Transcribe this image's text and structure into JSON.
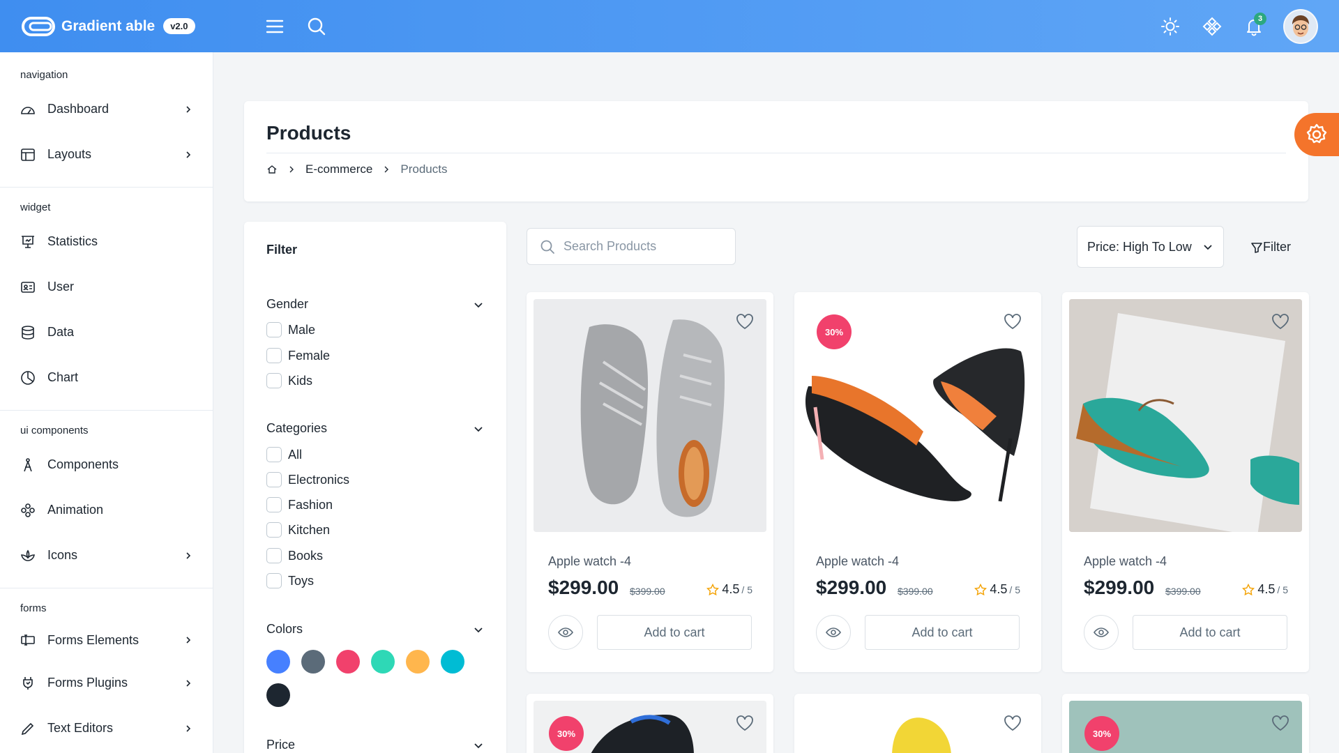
{
  "header": {
    "brand_name": "Gradient able",
    "version": "v2.0",
    "notification_count": "3",
    "icons": [
      "menu-icon",
      "search-icon",
      "sun-icon",
      "diamond-icon",
      "bell-icon"
    ]
  },
  "sidebar": {
    "sections": [
      {
        "caption": "navigation",
        "items": [
          {
            "label": "Dashboard",
            "icon": "dashboard-icon",
            "has_chevron": true
          },
          {
            "label": "Layouts",
            "icon": "layout-icon",
            "has_chevron": true
          }
        ]
      },
      {
        "caption": "widget",
        "items": [
          {
            "label": "Statistics",
            "icon": "statistics-icon",
            "has_chevron": false
          },
          {
            "label": "User",
            "icon": "user-card-icon",
            "has_chevron": false
          },
          {
            "label": "Data",
            "icon": "database-icon",
            "has_chevron": false
          },
          {
            "label": "Chart",
            "icon": "chart-icon",
            "has_chevron": false
          }
        ]
      },
      {
        "caption": "ui components",
        "items": [
          {
            "label": "Components",
            "icon": "components-icon",
            "has_chevron": false
          },
          {
            "label": "Animation",
            "icon": "animation-icon",
            "has_chevron": false
          },
          {
            "label": "Icons",
            "icon": "lotus-icon",
            "has_chevron": true
          }
        ]
      },
      {
        "caption": "forms",
        "items": [
          {
            "label": "Forms Elements",
            "icon": "form-elements-icon",
            "has_chevron": true
          },
          {
            "label": "Forms Plugins",
            "icon": "forms-plugins-icon",
            "has_chevron": true
          },
          {
            "label": "Text Editors",
            "icon": "text-editor-icon",
            "has_chevron": true
          }
        ]
      }
    ]
  },
  "page": {
    "title": "Products",
    "breadcrumb": {
      "level1": "E-commerce",
      "level2": "Products"
    }
  },
  "filter": {
    "title": "Filter",
    "gender": {
      "label": "Gender",
      "options": [
        "Male",
        "Female",
        "Kids"
      ]
    },
    "categories": {
      "label": "Categories",
      "options": [
        "All",
        "Electronics",
        "Fashion",
        "Kitchen",
        "Books",
        "Toys"
      ]
    },
    "colors": {
      "label": "Colors",
      "swatches": [
        "#4680ff",
        "#5b6b79",
        "#f1416c",
        "#2ed8b6",
        "#ffb64d",
        "#00bcd4",
        "#1d2630"
      ]
    },
    "price": {
      "label": "Price"
    }
  },
  "toolbar": {
    "search_placeholder": "Search Products",
    "sort_label": "Price: High To Low",
    "filter_label": "Filter"
  },
  "products": [
    {
      "name": "Apple watch -4",
      "price": "$299.00",
      "old_price": "$399.00",
      "rating": "4.5",
      "rating_out_of": "/ 5",
      "discount": "",
      "cart_label": "Add to cart"
    },
    {
      "name": "Apple watch -4",
      "price": "$299.00",
      "old_price": "$399.00",
      "rating": "4.5",
      "rating_out_of": "/ 5",
      "discount": "30%",
      "cart_label": "Add to cart"
    },
    {
      "name": "Apple watch -4",
      "price": "$299.00",
      "old_price": "$399.00",
      "rating": "4.5",
      "rating_out_of": "/ 5",
      "discount": "",
      "cart_label": "Add to cart"
    }
  ],
  "products_row2": [
    {
      "discount": "30%"
    },
    {
      "discount": ""
    },
    {
      "discount": "30%"
    }
  ],
  "colors": {
    "accent": "#3f8ef0",
    "fab": "#f4742b",
    "discount": "#f1416c",
    "success": "#2ca87f"
  }
}
